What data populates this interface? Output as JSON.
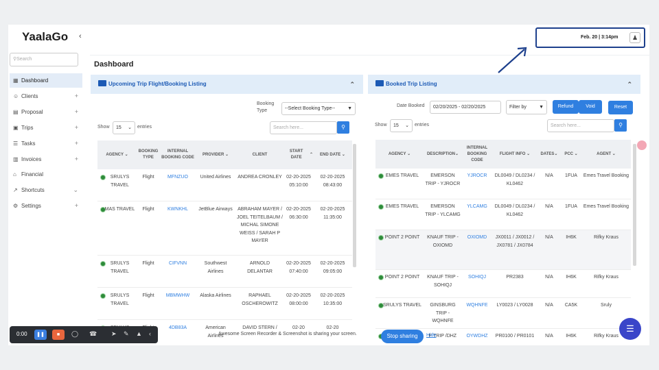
{
  "app": {
    "title": "YaalaGo",
    "collapse": "‹"
  },
  "header": {
    "datetime": "Feb. 20 | 3:14pm",
    "user_icon": "user-icon"
  },
  "sidebar": {
    "search_placeholder": "Search",
    "items": [
      {
        "label": "Dashboard",
        "icon": "▦",
        "plus": ""
      },
      {
        "label": "Clients",
        "icon": "☺",
        "plus": "+"
      },
      {
        "label": "Proposal",
        "icon": "▤",
        "plus": "+"
      },
      {
        "label": "Trips",
        "icon": "▣",
        "plus": "+"
      },
      {
        "label": "Tasks",
        "icon": "☰",
        "plus": "+"
      },
      {
        "label": "Invoices",
        "icon": "▥",
        "plus": "+"
      },
      {
        "label": "Financial",
        "icon": "⌂",
        "plus": ""
      },
      {
        "label": "Shortcuts",
        "icon": "↗",
        "plus": "⌄"
      },
      {
        "label": "Settings",
        "icon": "⚙",
        "plus": "+"
      }
    ]
  },
  "page": {
    "title": "Dashboard"
  },
  "left": {
    "title": "Upcoming Trip Flight/Booking Listing",
    "booking_type_label": "Booking Type",
    "booking_type_value": "--Select Booking Type--",
    "show_label": "Show",
    "show_value": "15",
    "entries_label": "entries",
    "search_placeholder": "Search here...",
    "headers": [
      "AGENCY",
      "BOOKING TYPE",
      "INTERNAL BOOKING CODE",
      "PROVIDER",
      "CLIENT",
      "START DATE",
      "END DATE"
    ],
    "rows": [
      [
        "SRULYS TRAVEL",
        "Flight",
        "MFNZUO",
        "United Airlines",
        "ANDREA CRONLEY",
        "02-20-2025 05:10:00",
        "02-20-2025 08:43:00"
      ],
      [
        "MAS TRAVEL",
        "Flight",
        "KWNKHL",
        "JetBlue Airways",
        "ABRAHAM MAYER / JOEL TEITELBAUM / MICHAL SIMONE WEISS / SARAH P MAYER",
        "02-20-2025 06:30:00",
        "02-20-2025 11:35:00"
      ],
      [
        "SRULYS TRAVEL",
        "Flight",
        "CIFVNN",
        "Southwest Airlines",
        "ARNOLD DELANTAR",
        "02-20-2025 07:40:00",
        "02-20-2025 09:05:00"
      ],
      [
        "SRULYS TRAVEL",
        "Flight",
        "MBMWHW",
        "Alaska Airlines",
        "RAPHAEL OSCHEROWITZ",
        "02-20-2025 08:00:00",
        "02-20-2025 10:35:00"
      ],
      [
        "SRULYS",
        "Flight",
        "4DB83A",
        "American Airlines",
        "DAVID STERN /",
        "02-20",
        "02-20"
      ]
    ]
  },
  "right": {
    "title": "Booked Trip Listing",
    "date_label": "Date Booked",
    "date_value": "02/20/2025 - 02/20/2025",
    "filter_label": "Filter by",
    "refund": "Refund",
    "void": "Void",
    "reset": "Reset",
    "show_label": "Show",
    "show_value": "15",
    "entries_label": "entries",
    "search_placeholder": "Search here...",
    "headers": [
      "AGENCY",
      "DESCRIPTION",
      "INTERNAL BOOKING CODE",
      "FLIGHT INFO",
      "DATES",
      "PCC",
      "AGENT"
    ],
    "rows": [
      [
        "EMES TRAVEL",
        "EMERSON TRIP - YJROCR",
        "YJROCR",
        "DL0049 / DL0234 / KL0462",
        "N/A",
        "1FUA",
        "Emes Travel Booking"
      ],
      [
        "EMES TRAVEL",
        "EMERSON TRIP - YLCAMG",
        "YLCAMG",
        "DL0049 / DL0234 / KL0462",
        "N/A",
        "1FUA",
        "Emes Travel Booking"
      ],
      [
        "POINT 2 POINT",
        "KNAUF TRIP - OXIOMD",
        "OXIOMD",
        "JX0011 / JX0012 / JX0781 / JX0784",
        "N/A",
        "IH6K",
        "Rifky Kraus"
      ],
      [
        "POINT 2 POINT",
        "KNAUF TRIP - SOHIQJ",
        "SOHIQJ",
        "PR2383",
        "N/A",
        "IH6K",
        "Rifky Kraus"
      ],
      [
        "SRULYS TRAVEL",
        "GINSBURG TRIP - WQHNFE",
        "WQHNFE",
        "LY0023 / LY0028",
        "N/A",
        "CA5K",
        "Sruly"
      ],
      [
        "",
        "F TRIP /DHZ",
        "OYWDHZ",
        "PR0100 / PR0101",
        "N/A",
        "IH6K",
        "Rifky Kraus"
      ]
    ]
  },
  "toolbar": {
    "time": "0:00"
  },
  "share": {
    "text": "Awesome Screen Recorder & Screenshot is sharing your screen.",
    "stop": "Stop sharing",
    "hide": "Hide"
  },
  "colors": {
    "accent": "#2f7fe0",
    "panel_header": "#e1edf9",
    "highlight_border": "#1c3f8c"
  }
}
